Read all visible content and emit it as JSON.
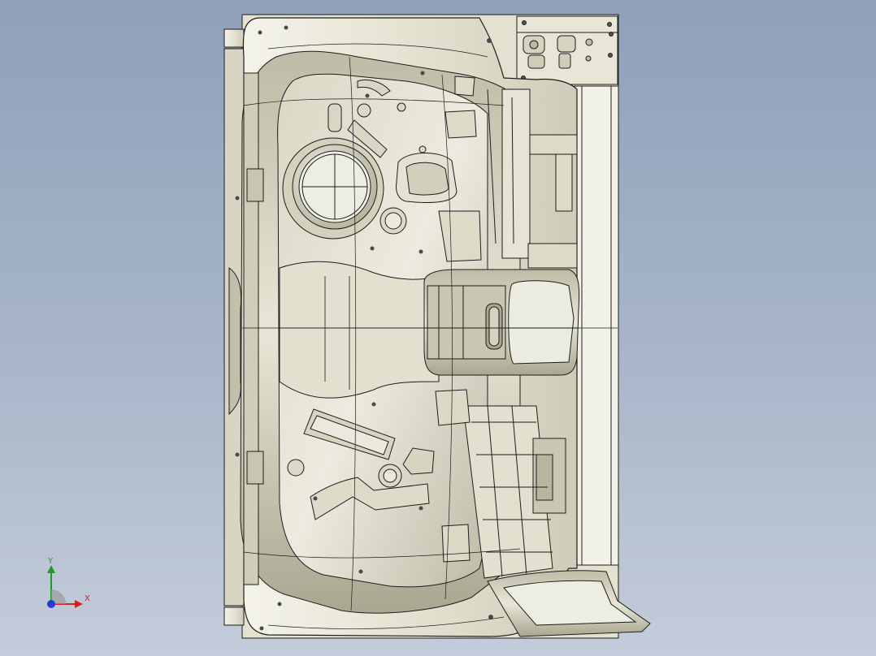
{
  "viewport": {
    "background_top": "#8fa0b8",
    "background_bottom": "#c3ccda"
  },
  "model": {
    "name": "",
    "surface_color": "#e9e7d9",
    "shade_color": "#b7b59f",
    "edge_color": "#1d1d1d"
  },
  "triad": {
    "x_label": "X",
    "y_label": "Y",
    "x_color": "#d22222",
    "y_color": "#1f9a2a",
    "z_color": "#1f3fd0"
  }
}
